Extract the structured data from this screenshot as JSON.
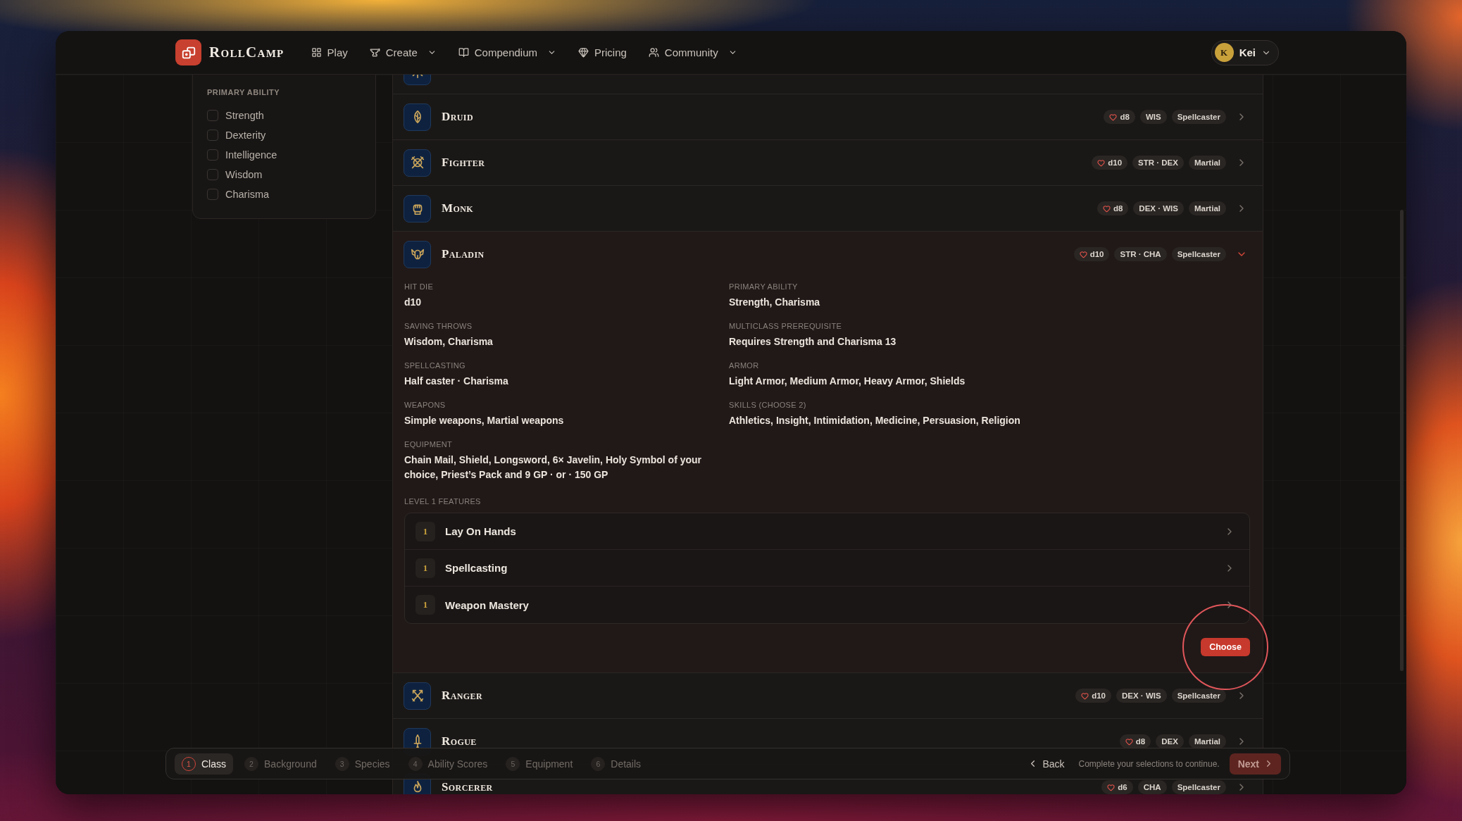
{
  "brand": {
    "name": "RollCamp"
  },
  "nav": {
    "items": [
      {
        "label": "Play",
        "dropdown": false
      },
      {
        "label": "Create",
        "dropdown": true
      },
      {
        "label": "Compendium",
        "dropdown": true
      },
      {
        "label": "Pricing",
        "dropdown": false
      },
      {
        "label": "Community",
        "dropdown": true
      }
    ],
    "user": {
      "initial": "K",
      "name": "Kei"
    }
  },
  "filters": {
    "heading": "PRIMARY ABILITY",
    "options": [
      {
        "label": "Strength",
        "checked": false
      },
      {
        "label": "Dexterity",
        "checked": false
      },
      {
        "label": "Intelligence",
        "checked": false
      },
      {
        "label": "Wisdom",
        "checked": false
      },
      {
        "label": "Charisma",
        "checked": false
      }
    ]
  },
  "classes": [
    {
      "kind": "clipped"
    },
    {
      "kind": "class",
      "name": "Druid",
      "hit_die": "d8",
      "abilities": "WIS",
      "role": "Spellcaster",
      "expanded": false
    },
    {
      "kind": "class",
      "name": "Fighter",
      "hit_die": "d10",
      "abilities": "STR · DEX",
      "role": "Martial",
      "expanded": false
    },
    {
      "kind": "class",
      "name": "Monk",
      "hit_die": "d8",
      "abilities": "DEX · WIS",
      "role": "Martial",
      "expanded": false
    },
    {
      "kind": "class",
      "name": "Paladin",
      "hit_die": "d10",
      "abilities": "STR · CHA",
      "role": "Spellcaster",
      "expanded": true,
      "details": [
        {
          "label": "HIT DIE",
          "value": "d10"
        },
        {
          "label": "PRIMARY ABILITY",
          "value": "Strength, Charisma"
        },
        {
          "label": "SAVING THROWS",
          "value": "Wisdom, Charisma"
        },
        {
          "label": "MULTICLASS PREREQUISITE",
          "value": "Requires Strength and Charisma 13"
        },
        {
          "label": "SPELLCASTING",
          "value": "Half caster · Charisma"
        },
        {
          "label": "ARMOR",
          "value": "Light Armor, Medium Armor, Heavy Armor, Shields"
        },
        {
          "label": "WEAPONS",
          "value": "Simple weapons, Martial weapons"
        },
        {
          "label": "SKILLS (CHOOSE 2)",
          "value": "Athletics, Insight, Intimidation, Medicine, Persuasion, Religion"
        },
        {
          "label": "EQUIPMENT",
          "value": "Chain Mail, Shield, Longsword, 6× Javelin, Holy Symbol of your choice, Priest’s Pack and 9 GP · or · 150 GP"
        }
      ],
      "features_heading": "LEVEL 1 FEATURES",
      "features": [
        {
          "badge": "1",
          "name": "Lay On Hands"
        },
        {
          "badge": "1",
          "name": "Spellcasting"
        },
        {
          "badge": "1",
          "name": "Weapon Mastery"
        }
      ],
      "choose_button": "Choose",
      "choose_highlighted": true
    },
    {
      "kind": "class",
      "name": "Ranger",
      "hit_die": "d10",
      "abilities": "DEX · WIS",
      "role": "Spellcaster",
      "expanded": false
    },
    {
      "kind": "class",
      "name": "Rogue",
      "hit_die": "d8",
      "abilities": "DEX",
      "role": "Martial",
      "expanded": false
    },
    {
      "kind": "class",
      "name": "Sorcerer",
      "hit_die": "d6",
      "abilities": "CHA",
      "role": "Spellcaster",
      "expanded": false
    }
  ],
  "stepper": {
    "steps": [
      {
        "number": "1",
        "label": "Class",
        "selected": true
      },
      {
        "number": "2",
        "label": "Background",
        "selected": false
      },
      {
        "number": "3",
        "label": "Species",
        "selected": false
      },
      {
        "number": "4",
        "label": "Ability Scores",
        "selected": false
      },
      {
        "number": "5",
        "label": "Equipment",
        "selected": false
      },
      {
        "number": "6",
        "label": "Details",
        "selected": false
      }
    ],
    "back": "Back",
    "hint": "Complete your selections to continue.",
    "next": {
      "label": "Next",
      "disabled": true
    }
  }
}
